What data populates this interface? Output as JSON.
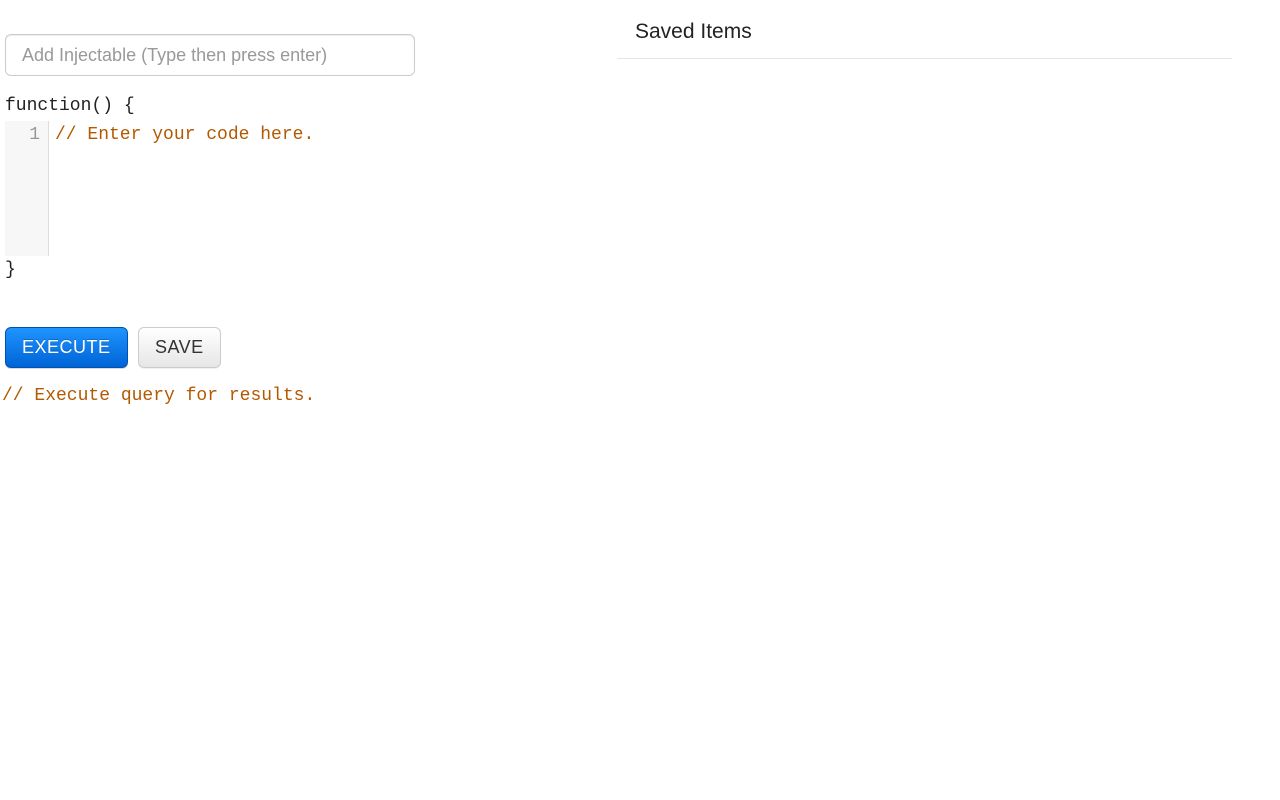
{
  "injectable": {
    "placeholder": "Add Injectable (Type then press enter)",
    "value": ""
  },
  "code": {
    "open": "function() {",
    "close": "}",
    "gutter_line": "1",
    "content": "// Enter your code here."
  },
  "buttons": {
    "execute": "EXECUTE",
    "save": "SAVE"
  },
  "results": {
    "placeholder": "// Execute query for results."
  },
  "saved": {
    "title": "Saved Items"
  }
}
